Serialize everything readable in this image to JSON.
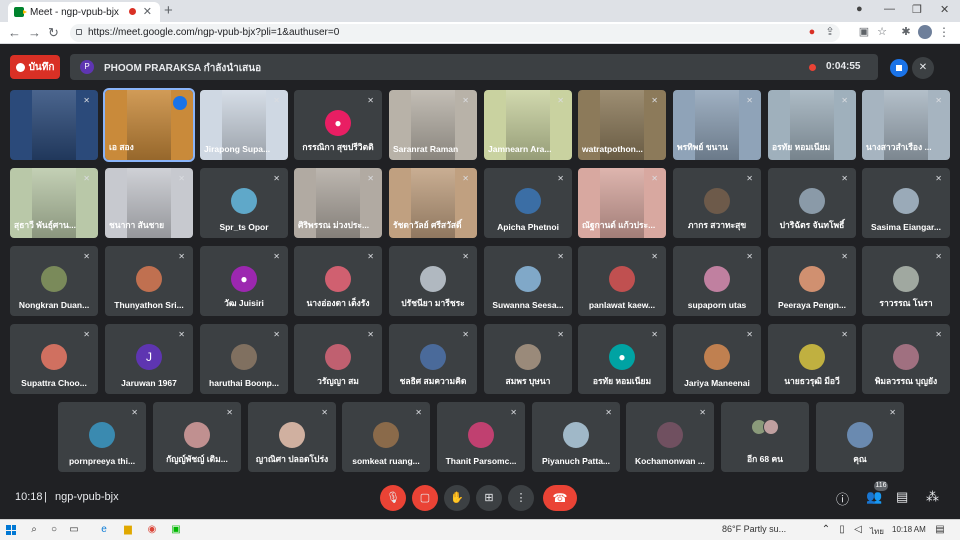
{
  "browser": {
    "tab_title": "Meet - ngp-vpub-bjx",
    "url": "https://meet.google.com/ngp-vpub-bjx?pli=1&authuser=0"
  },
  "header": {
    "record_label": "บันทึก",
    "presenter_initial": "P",
    "presenter_text": "PHOOM PRARAKSA กำลังนำเสนอ",
    "recording_time": "0:04:55"
  },
  "participants": [
    {
      "name": "",
      "video": true,
      "bg": "#2b4a7a"
    },
    {
      "name": "เอ สอง",
      "video": true,
      "bg": "#c98a3a",
      "speaking": true
    },
    {
      "name": "Jirapong Supa...",
      "video": true,
      "bg": "#cfd8e3"
    },
    {
      "name": "กรรณิกา สุขปรีวิตติ",
      "avatar": "#e91e63",
      "icon": true
    },
    {
      "name": "Saranrat Raman",
      "video": true,
      "bg": "#b8b2a8"
    },
    {
      "name": "Jamnearn Ara...",
      "video": true,
      "bg": "#c9d2a0"
    },
    {
      "name": "watratpothon...",
      "video": true,
      "bg": "#8c7a5a"
    },
    {
      "name": "พรทิพย์ ขนาน",
      "video": true,
      "bg": "#8fa3b8"
    },
    {
      "name": "อรทัย หอมเนียม",
      "video": true,
      "bg": "#9fb0bc"
    },
    {
      "name": "นางสาวสำเรือง ...",
      "video": true,
      "bg": "#a6b4c0"
    },
    {
      "name": "สุธาวี พันธุ์ศาน...",
      "video": true,
      "bg": "#b9c8a8"
    },
    {
      "name": "ชนากา สันชาย",
      "video": true,
      "bg": "#c7c9cf"
    },
    {
      "name": "Spr_ts Opor",
      "avatar": "#5fa8c9"
    },
    {
      "name": "ศิริพรรณ ม่วงประ...",
      "video": true,
      "bg": "#b1aaa2"
    },
    {
      "name": "รัชดาวัลย์ ศรีสวัสดิ์",
      "video": true,
      "bg": "#c0a080"
    },
    {
      "name": "Apicha Phetnoi",
      "avatar": "#3b6ea5"
    },
    {
      "name": "ณัฐกานต์ แก้วประ...",
      "video": true,
      "bg": "#d8a8a0"
    },
    {
      "name": "ภากร สวาทะสุข",
      "avatar": "#6d5a4a"
    },
    {
      "name": "ปาริฉัตร จันทโพธิ์",
      "avatar": "#8a9aa8"
    },
    {
      "name": "Sasima Eiangar...",
      "avatar": "#9aaab8"
    },
    {
      "name": "Nongkran Duan...",
      "avatar": "#7a8a5a"
    },
    {
      "name": "Thunyathon Sri...",
      "avatar": "#c07050"
    },
    {
      "name": "วัฒ Juisiri",
      "avatar": "#9c27b0",
      "icon": true
    },
    {
      "name": "นางอ่องดา เต็งรัง",
      "avatar": "#d06070"
    },
    {
      "name": "ปรัชนียา มารีชระ",
      "avatar": "#b0b8c0"
    },
    {
      "name": "Suwanna Seesa...",
      "avatar": "#80a8c8"
    },
    {
      "name": "panlawat kaew...",
      "avatar": "#c05050"
    },
    {
      "name": "supaporn utas",
      "avatar": "#c080a0"
    },
    {
      "name": "Peeraya Pengn...",
      "avatar": "#d09070"
    },
    {
      "name": "ราวรรณ โนรา",
      "avatar": "#a0a8a0"
    },
    {
      "name": "Supattra Choo...",
      "avatar": "#d07060"
    },
    {
      "name": "Jaruwan 1967",
      "avatar": "#5e35b1",
      "letter": "J"
    },
    {
      "name": "haruthai Boonp...",
      "avatar": "#807060"
    },
    {
      "name": "วรัญญา สม",
      "avatar": "#c06070"
    },
    {
      "name": "ชลธิศ สมความคิด",
      "avatar": "#4a6a9a"
    },
    {
      "name": "สมพร บุษนา",
      "avatar": "#9a8a7a"
    },
    {
      "name": "อรทัย หอมเนียม",
      "avatar": "#00a3a3",
      "icon": true
    },
    {
      "name": "Jariya Maneenai",
      "avatar": "#c08050"
    },
    {
      "name": "นายธวรุฒิ มีอวี",
      "avatar": "#c0b040"
    },
    {
      "name": "พิมลวรรณ บุญยัง",
      "avatar": "#a07080"
    },
    {
      "name": "pornpreeya thi...",
      "avatar": "#3a8ab0"
    },
    {
      "name": "กัญญ์พัชญ์ เดิม...",
      "avatar": "#c09090"
    },
    {
      "name": "ญาณิศา ปลอดโปร่ง",
      "avatar": "#d0b0a0"
    },
    {
      "name": "somkeat ruang...",
      "avatar": "#8a6a4a"
    },
    {
      "name": "Thanit Parsomc...",
      "avatar": "#c04070"
    },
    {
      "name": "Piyanuch Patta...",
      "avatar": "#a0b8c8"
    },
    {
      "name": "Kochamonwan ...",
      "avatar": "#705060"
    },
    {
      "name": "อีก 68 คน",
      "more": true
    },
    {
      "name": "คุณ",
      "avatar": "#6a8ab0"
    }
  ],
  "footer": {
    "time": "10:18",
    "separator": "|",
    "meeting_code": "ngp-vpub-bjx",
    "participant_count": "116"
  },
  "taskbar": {
    "weather": "86°F  Partly su...",
    "language": "ไทย",
    "clock": "10:18 AM"
  },
  "colors": {
    "background": "#202124",
    "tile": "#3c4043",
    "accent_red": "#ea4335",
    "accent_blue": "#1a73e8"
  }
}
